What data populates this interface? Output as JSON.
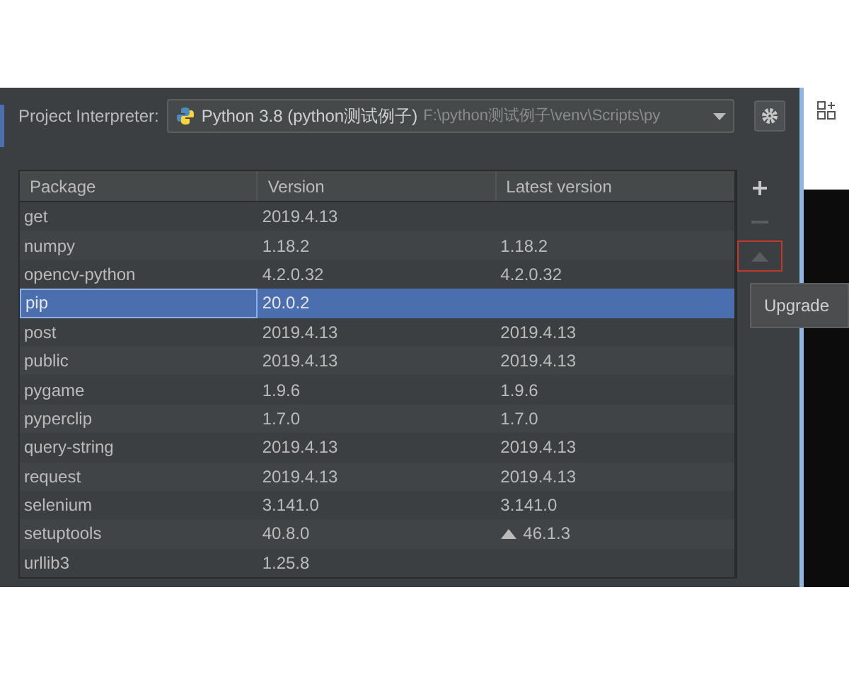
{
  "interpreter": {
    "label": "Project Interpreter:",
    "name": "Python 3.8 (python测试例子)",
    "path": "F:\\python测试例子\\venv\\Scripts\\py"
  },
  "table": {
    "columns": [
      "Package",
      "Version",
      "Latest version"
    ],
    "rows": [
      {
        "package": "get",
        "version": "2019.4.13",
        "latest": "",
        "upgrade": false,
        "selected": false
      },
      {
        "package": "numpy",
        "version": "1.18.2",
        "latest": "1.18.2",
        "upgrade": false,
        "selected": false
      },
      {
        "package": "opencv-python",
        "version": "4.2.0.32",
        "latest": "4.2.0.32",
        "upgrade": false,
        "selected": false
      },
      {
        "package": "pip",
        "version": "20.0.2",
        "latest": "",
        "upgrade": false,
        "selected": true
      },
      {
        "package": "post",
        "version": "2019.4.13",
        "latest": "2019.4.13",
        "upgrade": false,
        "selected": false
      },
      {
        "package": "public",
        "version": "2019.4.13",
        "latest": "2019.4.13",
        "upgrade": false,
        "selected": false
      },
      {
        "package": "pygame",
        "version": "1.9.6",
        "latest": "1.9.6",
        "upgrade": false,
        "selected": false
      },
      {
        "package": "pyperclip",
        "version": "1.7.0",
        "latest": "1.7.0",
        "upgrade": false,
        "selected": false
      },
      {
        "package": "query-string",
        "version": "2019.4.13",
        "latest": "2019.4.13",
        "upgrade": false,
        "selected": false
      },
      {
        "package": "request",
        "version": "2019.4.13",
        "latest": "2019.4.13",
        "upgrade": false,
        "selected": false
      },
      {
        "package": "selenium",
        "version": "3.141.0",
        "latest": "3.141.0",
        "upgrade": false,
        "selected": false
      },
      {
        "package": "setuptools",
        "version": "40.8.0",
        "latest": "46.1.3",
        "upgrade": true,
        "selected": false
      },
      {
        "package": "urllib3",
        "version": "1.25.8",
        "latest": "",
        "upgrade": false,
        "selected": false
      }
    ]
  },
  "side_buttons": [
    {
      "kind": "add",
      "disabled": false,
      "highlighted": false
    },
    {
      "kind": "remove",
      "disabled": true,
      "highlighted": false
    },
    {
      "kind": "upgrade",
      "disabled": true,
      "highlighted": true
    }
  ],
  "tooltip": {
    "text": "Upgrade"
  }
}
